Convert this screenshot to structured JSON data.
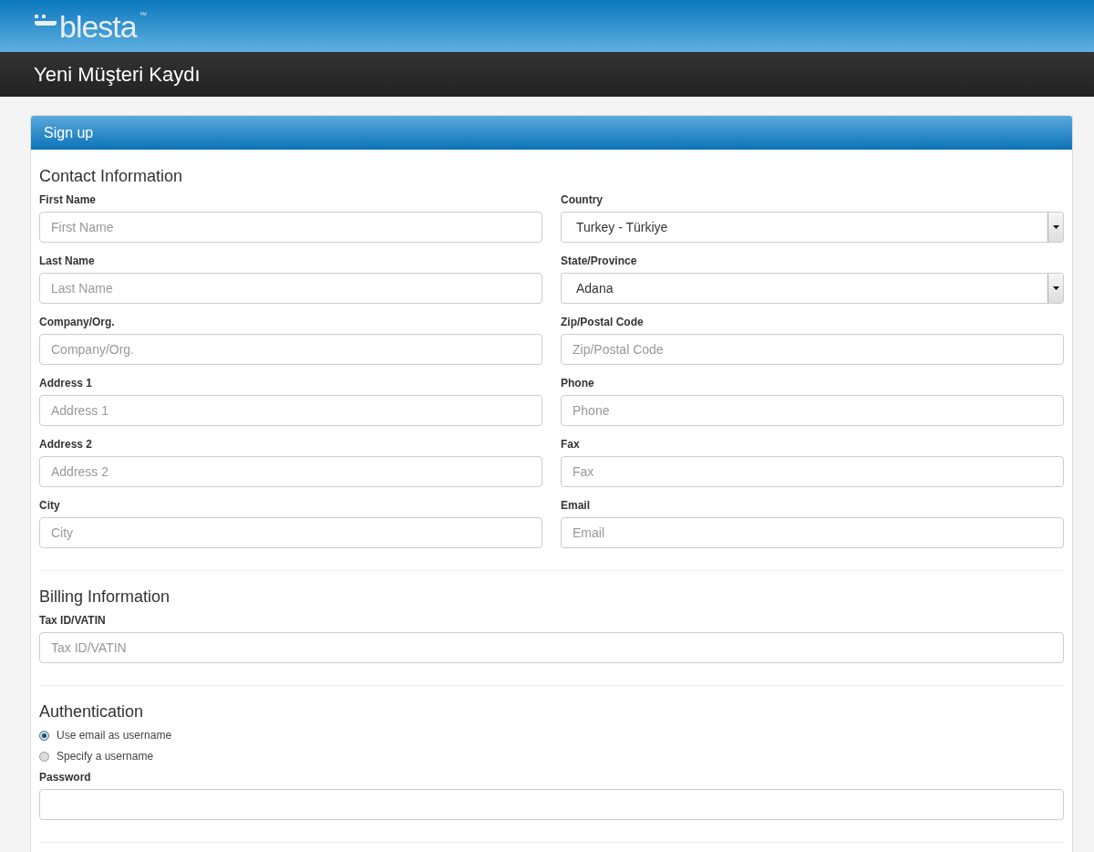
{
  "logo": {
    "text": "blesta",
    "trademark": "™"
  },
  "page_title": "Yeni Müşteri Kaydı",
  "panel": {
    "title": "Sign up",
    "sections": [
      {
        "heading": "Contact Information",
        "kind": "two_column",
        "fields": [
          {
            "kind": "text",
            "label": "First Name",
            "placeholder": "First Name"
          },
          {
            "kind": "select",
            "label": "Country",
            "value": "Turkey - Türkiye"
          },
          {
            "kind": "text",
            "label": "Last Name",
            "placeholder": "Last Name"
          },
          {
            "kind": "select",
            "label": "State/Province",
            "value": "Adana"
          },
          {
            "kind": "text",
            "label": "Company/Org.",
            "placeholder": "Company/Org."
          },
          {
            "kind": "text",
            "label": "Zip/Postal Code",
            "placeholder": "Zip/Postal Code"
          },
          {
            "kind": "text",
            "label": "Address 1",
            "placeholder": "Address 1"
          },
          {
            "kind": "text",
            "label": "Phone",
            "placeholder": "Phone"
          },
          {
            "kind": "text",
            "label": "Address 2",
            "placeholder": "Address 2"
          },
          {
            "kind": "text",
            "label": "Fax",
            "placeholder": "Fax"
          },
          {
            "kind": "text",
            "label": "City",
            "placeholder": "City"
          },
          {
            "kind": "text",
            "label": "Email",
            "placeholder": "Email"
          }
        ]
      },
      {
        "heading": "Billing Information",
        "kind": "single_column",
        "fields": [
          {
            "kind": "text",
            "label": "Tax ID/VATIN",
            "placeholder": "Tax ID/VATIN"
          }
        ]
      },
      {
        "heading": "Authentication",
        "kind": "single_column",
        "fields": [
          {
            "kind": "radio",
            "label": "Use email as username",
            "selected": true
          },
          {
            "kind": "radio",
            "label": "Specify a username",
            "selected": false
          },
          {
            "kind": "text",
            "label": "Password"
          }
        ]
      }
    ]
  }
}
